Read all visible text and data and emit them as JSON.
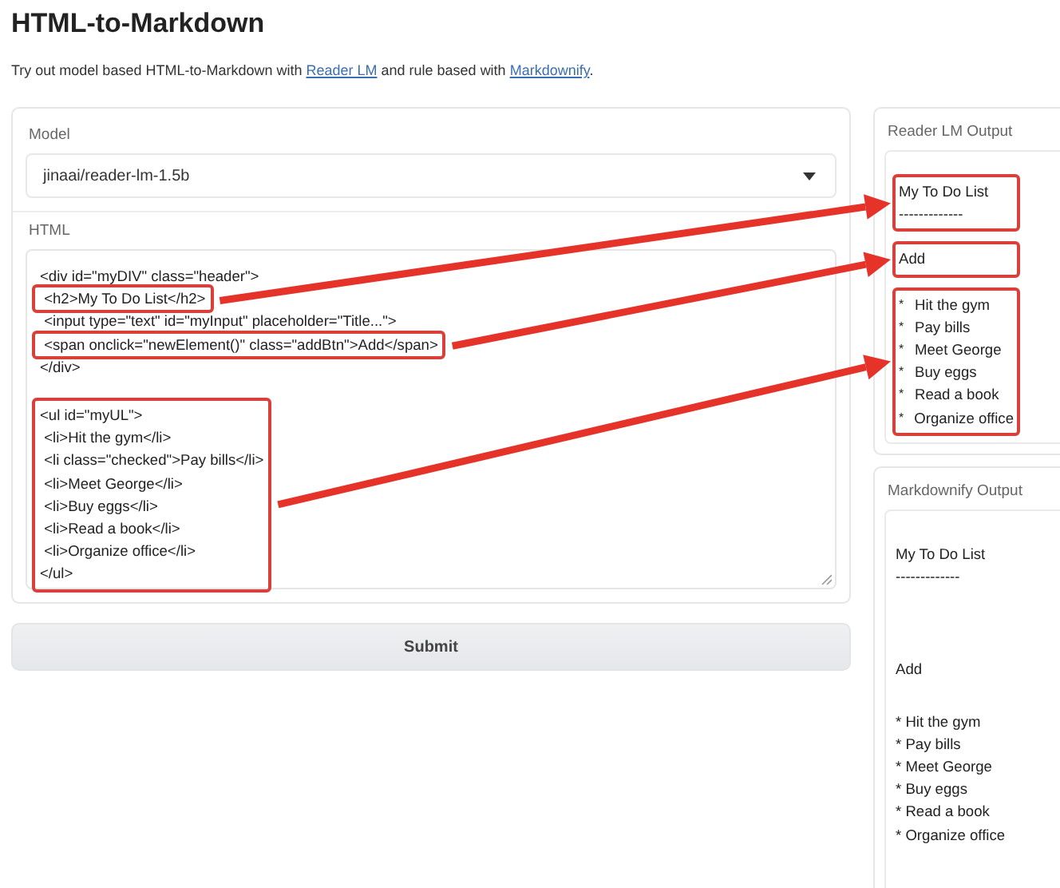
{
  "title": "HTML-to-Markdown",
  "intro": [
    {
      "text": "Try out model based HTML-to-Markdown with ",
      "link": false
    },
    {
      "text": "Reader LM",
      "link": true
    },
    {
      "text": " and rule based with ",
      "link": false
    },
    {
      "text": "Markdownify",
      "link": true
    },
    {
      "text": ".",
      "link": false
    }
  ],
  "model": {
    "label": "Model",
    "value": "jinaai/reader-lm-1.5b"
  },
  "html_input": {
    "label": "HTML",
    "blocks": [
      {
        "lines": [
          "<div id=\"myDIV\" class=\"header\">"
        ],
        "highlighted": false
      },
      {
        "lines": [
          " <h2>My To Do List</h2>"
        ],
        "highlighted": true
      },
      {
        "lines": [
          " <input type=\"text\" id=\"myInput\" placeholder=\"Title...\">"
        ],
        "highlighted": false
      },
      {
        "lines": [
          " <span onclick=\"newElement()\" class=\"addBtn\">Add</span>"
        ],
        "highlighted": true
      },
      {
        "lines": [
          "</div>"
        ],
        "highlighted": false
      },
      {
        "lines": [
          "<ul id=\"myUL\">",
          " <li>Hit the gym</li>",
          " <li class=\"checked\">Pay bills</li>",
          " <li>Meet George</li>",
          " <li>Buy eggs</li>",
          " <li>Read a book</li>",
          " <li>Organize office</li>",
          "</ul>"
        ],
        "highlighted": true
      }
    ]
  },
  "submit": "Submit",
  "reader_output": {
    "label": "Reader LM Output",
    "blocks": [
      {
        "kind": "text",
        "lines": [
          "My To Do List",
          "-------------"
        ],
        "highlighted": true
      },
      {
        "kind": "text",
        "lines": [
          "Add"
        ],
        "highlighted": true
      },
      {
        "kind": "list",
        "items": [
          {
            "marker": "*",
            "text": "Hit the gym"
          },
          {
            "marker": "*",
            "text": "Pay bills"
          },
          {
            "marker": "*",
            "text": "Meet George"
          },
          {
            "marker": "*",
            "text": "Buy eggs"
          },
          {
            "marker": "*",
            "text": "Read a book"
          },
          {
            "marker": "*",
            "text": "Organize office"
          }
        ],
        "highlighted": true
      }
    ]
  },
  "markdownify_output": {
    "label": "Markdownify Output",
    "blocks": [
      {
        "kind": "text",
        "lines": [
          "My To Do List",
          "-------------"
        ],
        "highlighted": false
      },
      {
        "kind": "text",
        "lines": [
          "Add"
        ],
        "highlighted": false
      },
      {
        "kind": "text",
        "lines": [
          "* Hit the gym",
          "* Pay bills",
          "* Meet George",
          "* Buy eggs",
          "* Read a book",
          "* Organize office"
        ],
        "highlighted": false
      }
    ]
  }
}
